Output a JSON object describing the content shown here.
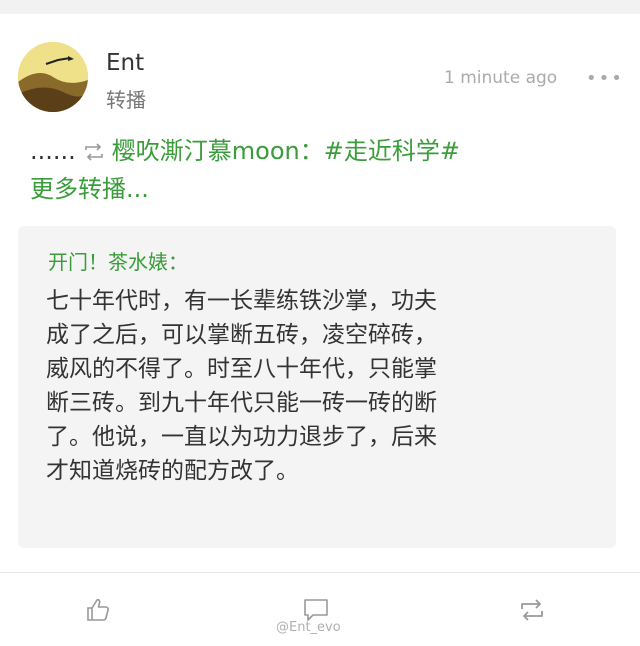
{
  "post": {
    "username": "Ent",
    "subtitle": "转播",
    "timestamp": "1 minute ago",
    "more_label": "•••"
  },
  "repost": {
    "ellipsis": "......",
    "user": "樱吹澌汀慕moon：",
    "topic": "#走近科学#",
    "more": "更多转播..."
  },
  "quote": {
    "author": "开门！茶水婊：",
    "lines": [
      "七十年代时，有一长辈练铁沙掌，功夫",
      "成了之后，可以掌断五砖，凌空碎砖，",
      "威风的不得了。时至八十年代，只能掌",
      "断三砖。到九十年代只能一砖一砖的断",
      "了。他说，一直以为功力退步了，后来",
      "才知道烧砖的配方改了。"
    ]
  },
  "actions": {
    "like_icon": "thumbs-up-icon",
    "comment_icon": "comment-icon",
    "repost_icon": "repost-icon"
  },
  "watermark": "@Ent_evo"
}
